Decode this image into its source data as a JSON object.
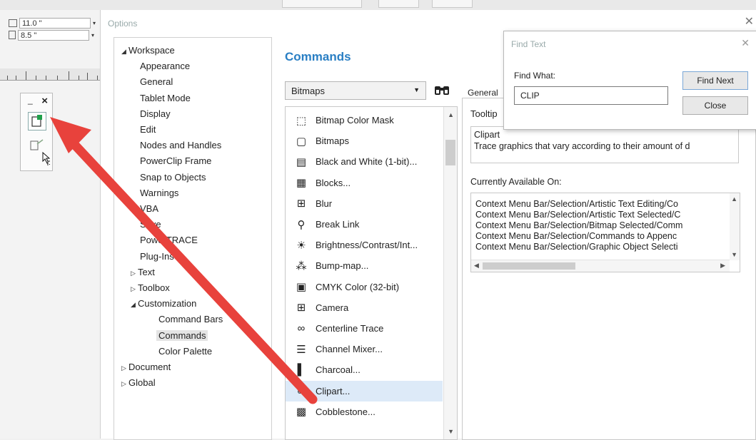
{
  "property_bar": {
    "width_value": "11.0 \"",
    "height_value": "8.5 \""
  },
  "toolpanel": {
    "min_glyph": "_",
    "close_glyph": "×"
  },
  "dialog": {
    "title": "Options",
    "close_glyph": "✕"
  },
  "tree": [
    {
      "label": "Workspace",
      "arrow": "◢",
      "indent": 0
    },
    {
      "label": "Appearance",
      "indent": 1
    },
    {
      "label": "General",
      "indent": 1
    },
    {
      "label": "Tablet Mode",
      "indent": 1
    },
    {
      "label": "Display",
      "indent": 1
    },
    {
      "label": "Edit",
      "indent": 1
    },
    {
      "label": "Nodes and Handles",
      "indent": 1
    },
    {
      "label": "PowerClip Frame",
      "indent": 1
    },
    {
      "label": "Snap to Objects",
      "indent": 1
    },
    {
      "label": "Warnings",
      "indent": 1
    },
    {
      "label": "VBA",
      "indent": 1
    },
    {
      "label": "Save",
      "indent": 1
    },
    {
      "label": "PowerTRACE",
      "indent": 1
    },
    {
      "label": "Plug-Ins",
      "indent": 1
    },
    {
      "label": "Text",
      "arrow": "▷",
      "indent": 0.5
    },
    {
      "label": "Toolbox",
      "arrow": "▷",
      "indent": 0.5
    },
    {
      "label": "Customization",
      "arrow": "◢",
      "indent": 0.5
    },
    {
      "label": "Command Bars",
      "indent": 2
    },
    {
      "label": "Commands",
      "indent": 2,
      "selected": true
    },
    {
      "label": "Color Palette",
      "indent": 2
    },
    {
      "label": "Document",
      "arrow": "▷",
      "indent": 0
    },
    {
      "label": "Global",
      "arrow": "▷",
      "indent": 0
    }
  ],
  "commands": {
    "title": "Commands",
    "category": "Bitmaps",
    "find_icon": "binoculars-icon",
    "items": [
      {
        "label": "Bitmap Color Mask",
        "icon": "color-mask-icon",
        "glyph": "⬚"
      },
      {
        "label": "Bitmaps",
        "icon": "bitmaps-icon",
        "glyph": "▢"
      },
      {
        "label": "Black and White (1-bit)...",
        "icon": "bw-icon",
        "glyph": "▤"
      },
      {
        "label": "Blocks...",
        "icon": "blocks-icon",
        "glyph": "▦"
      },
      {
        "label": "Blur",
        "icon": "blur-icon",
        "glyph": "⊞"
      },
      {
        "label": "Break Link",
        "icon": "break-link-icon",
        "glyph": "⚲"
      },
      {
        "label": "Brightness/Contrast/Int...",
        "icon": "brightness-icon",
        "glyph": "☀"
      },
      {
        "label": "Bump-map...",
        "icon": "bumpmap-icon",
        "glyph": "⁂"
      },
      {
        "label": "CMYK Color (32-bit)",
        "icon": "cmyk-icon",
        "glyph": "▣"
      },
      {
        "label": "Camera",
        "icon": "camera-icon",
        "glyph": "⊞"
      },
      {
        "label": "Centerline Trace",
        "icon": "centerline-trace-icon",
        "glyph": "∞"
      },
      {
        "label": "Channel Mixer...",
        "icon": "channel-mixer-icon",
        "glyph": "☰"
      },
      {
        "label": "Charcoal...",
        "icon": "charcoal-icon",
        "glyph": "▌"
      },
      {
        "label": "Clipart...",
        "icon": "clipart-icon",
        "glyph": "✐",
        "selected": true
      },
      {
        "label": "Cobblestone...",
        "icon": "cobblestone-icon",
        "glyph": "▩"
      }
    ]
  },
  "general": {
    "tab": "General",
    "tooltip_label": "Tooltip",
    "tooltip_line1": "Clipart",
    "tooltip_line2": "Trace graphics that vary according to their amount of d",
    "available_label": "Currently Available On:",
    "available": [
      "Context Menu Bar/Selection/Artistic Text Editing/Co",
      "Context Menu Bar/Selection/Artistic Text Selected/C",
      "Context Menu Bar/Selection/Bitmap Selected/Comm",
      "Context Menu Bar/Selection/Commands to Appenc",
      "Context Menu Bar/Selection/Graphic Object Selecti"
    ]
  },
  "find_dialog": {
    "title": "Find Text",
    "close_glyph": "✕",
    "label": "Find What:",
    "value": "CLIP",
    "find_next": "Find Next",
    "close": "Close"
  },
  "colors": {
    "accent": "#2a7fc4",
    "arrow": "#e8423c",
    "selection": "#ddeaf8"
  }
}
